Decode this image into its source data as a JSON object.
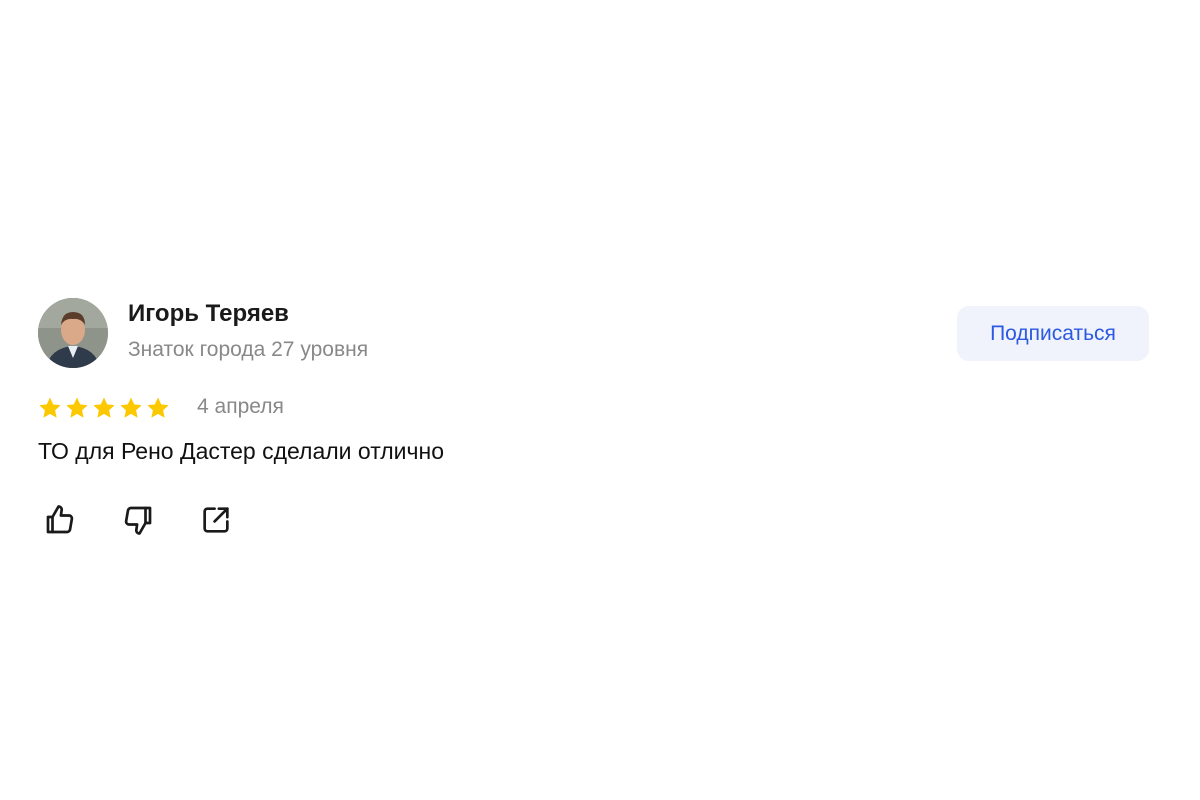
{
  "author": {
    "name": "Игорь Теряев",
    "level": "Знаток города 27 уровня",
    "avatar": "author-photo"
  },
  "subscribe_button": {
    "label": "Подписаться",
    "color": "#2b59e0",
    "background": "#f0f3fb"
  },
  "rating": {
    "value": 5,
    "max": 5,
    "star_color": "#fcc800"
  },
  "date": "4 апреля",
  "text": "ТО для Рено Дастер сделали отлично",
  "actions": [
    {
      "icon": "thumbs-up-icon",
      "name": "like"
    },
    {
      "icon": "thumbs-down-icon",
      "name": "dislike"
    },
    {
      "icon": "share-icon",
      "name": "share"
    }
  ]
}
